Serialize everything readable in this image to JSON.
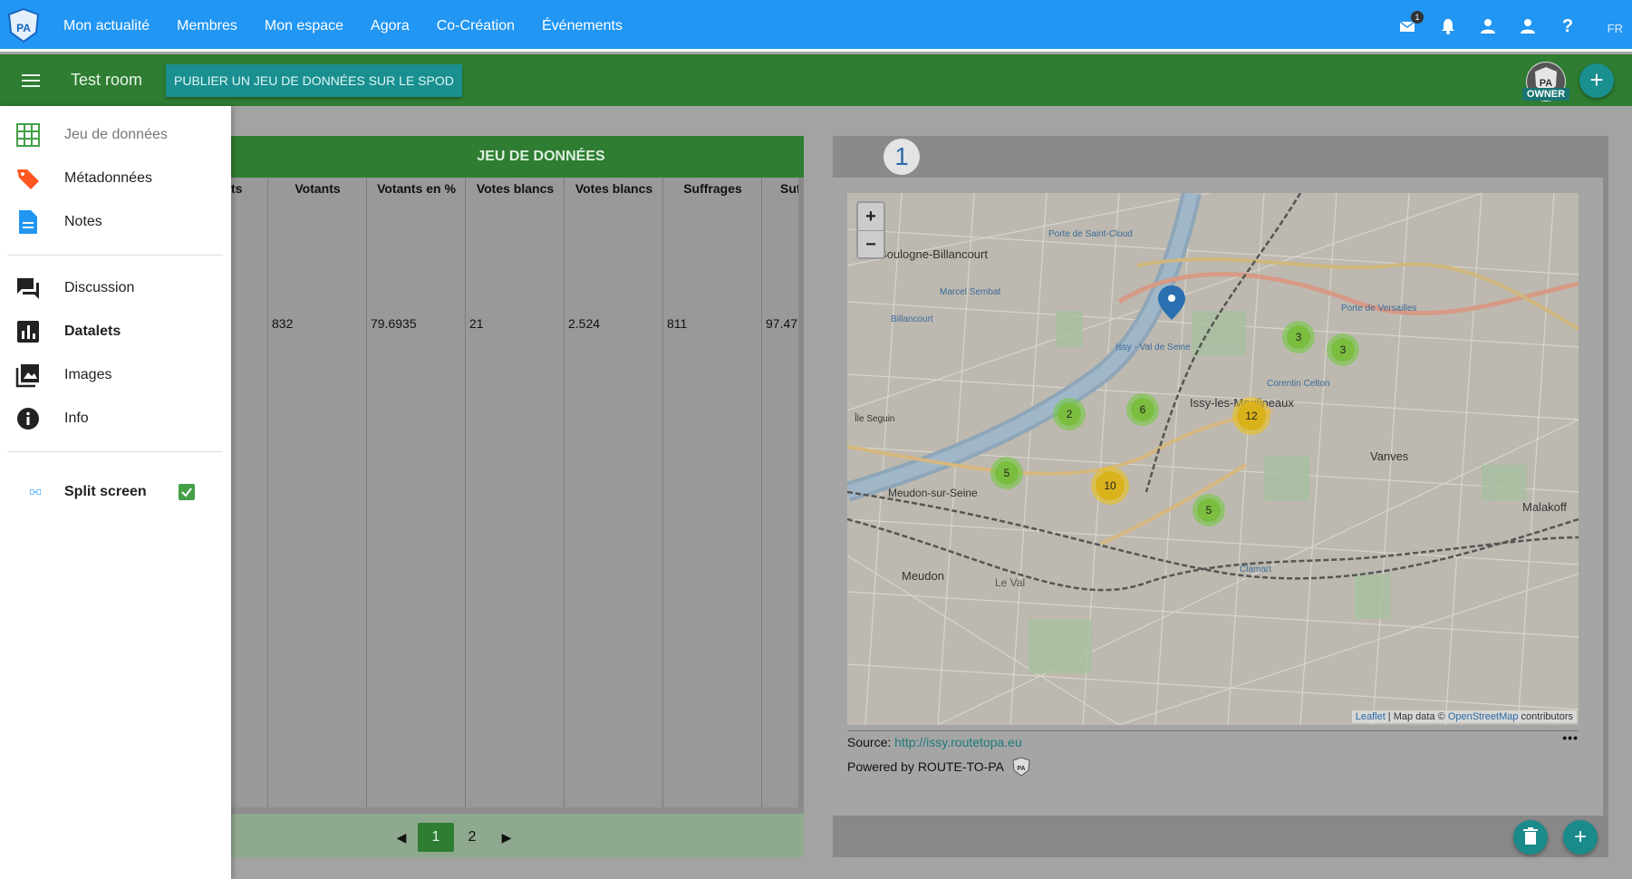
{
  "topbar": {
    "logo_text": "ROUTE TO PA",
    "nav": [
      "Mon actualité",
      "Membres",
      "Mon espace",
      "Agora",
      "Co-Création",
      "Événements"
    ],
    "mail_badge": "1",
    "lang": "FR",
    "icons": [
      "mail-icon",
      "bell-icon",
      "user-icon",
      "account-icon",
      "help-icon"
    ],
    "help_label": "?"
  },
  "room": {
    "title": "Test room",
    "publish_label": "PUBLIER UN JEU DE DONNÉES SUR LE SPOD",
    "owner_label": "OWNER",
    "add_label": "+"
  },
  "drawer": {
    "items": [
      {
        "label": "Jeu de données",
        "icon": "grid-icon"
      },
      {
        "label": "Métadonnées",
        "icon": "tag-icon"
      },
      {
        "label": "Notes",
        "icon": "document-icon"
      },
      {
        "label": "Discussion",
        "icon": "forum-icon"
      },
      {
        "label": "Datalets",
        "icon": "bar-chart-icon"
      },
      {
        "label": "Images",
        "icon": "images-icon"
      },
      {
        "label": "Info",
        "icon": "info-icon"
      }
    ],
    "split_screen_label": "Split screen",
    "split_screen_checked": true
  },
  "dataset": {
    "header": "JEU DE DONNÉES",
    "columns": [
      "ts",
      "Votants",
      "Votants en %",
      "Votes blancs",
      "Votes blancs",
      "Suffrages",
      "Suff"
    ],
    "row": [
      "",
      "832",
      "79.6935",
      "21",
      "2.524",
      "811",
      "97.47"
    ],
    "pages": [
      "1",
      "2"
    ],
    "active_page": "1",
    "prev": "◀",
    "next": "▶"
  },
  "map": {
    "panel_number": "1",
    "zoom_in": "+",
    "zoom_out": "−",
    "places": [
      "Boulogne-Billancourt",
      "Issy-les-Moulineaux",
      "Vanves",
      "Meudon-sur-Seine",
      "Meudon",
      "Malakoff",
      "Porte de Saint-Cloud",
      "Porte de Versailles",
      "Marcel Sembat",
      "Billancourt",
      "Corentin Celton",
      "Clamart",
      "Le Val",
      "Île Seguin",
      "Issy - Val de Seine"
    ],
    "clusters": [
      "3",
      "3",
      "6",
      "2",
      "12",
      "5",
      "10",
      "5"
    ],
    "attribution_leaflet": "Leaflet",
    "attribution_sep": " | Map data © ",
    "attribution_osm": "OpenStreetMap",
    "attribution_rest": " contributors",
    "source_label": "Source: ",
    "source_url": "http://issy.routetopa.eu",
    "powered_by": "Powered by ROUTE-TO-PA",
    "more_label": "•••",
    "delete_icon": "delete-icon",
    "add_label": "+"
  },
  "colors": {
    "topbar": "#2196f3",
    "roombar": "#2e7d32",
    "accent": "#1a8f8f"
  }
}
